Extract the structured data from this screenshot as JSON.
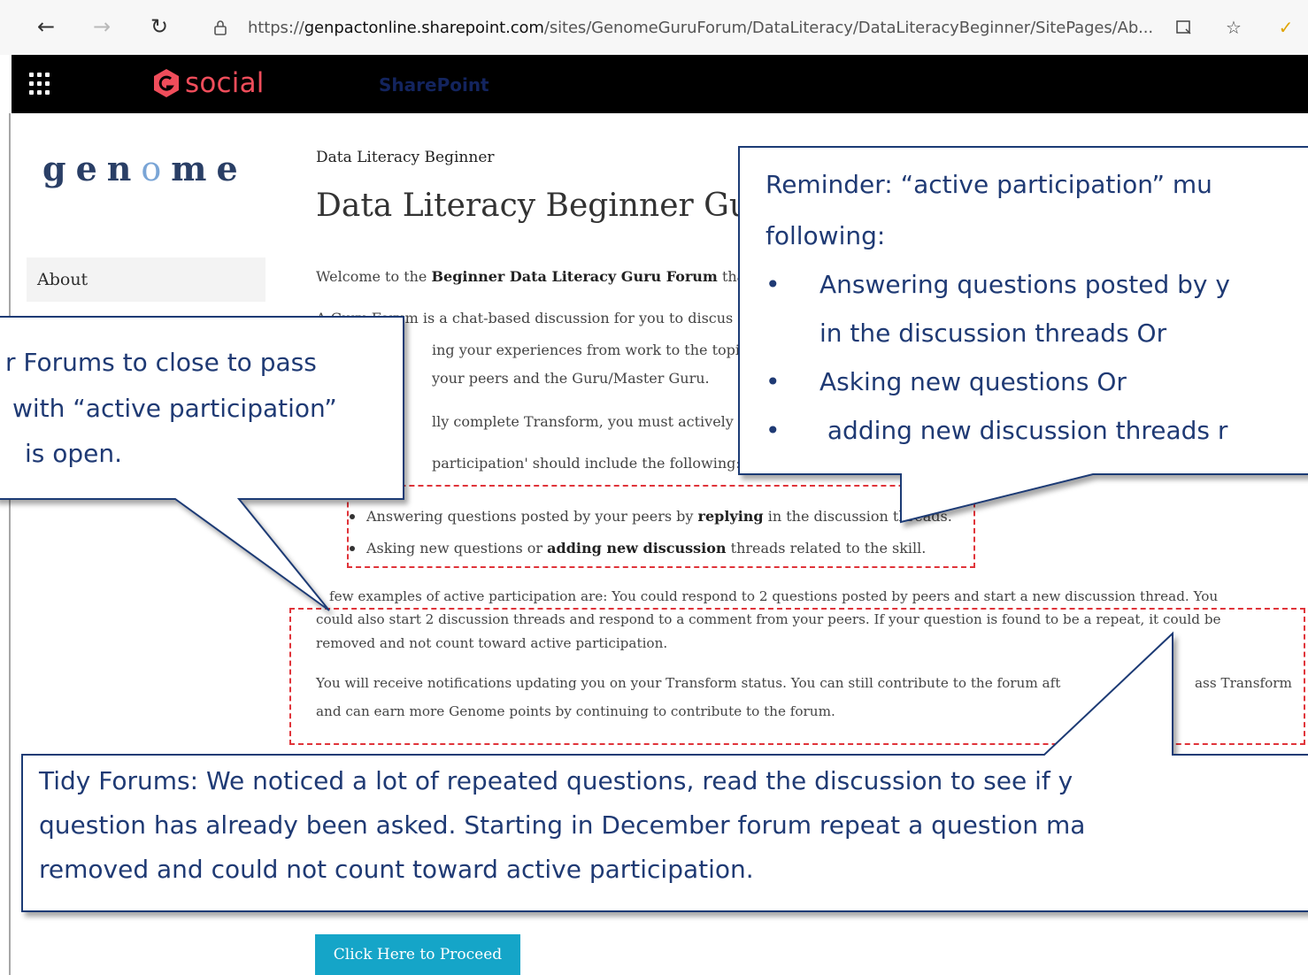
{
  "browser": {
    "url_prefix": "https://",
    "url_domain": "genpactonline.sharepoint.com",
    "url_path": "/sites/GenomeGuruForum/DataLiteracy/DataLiteracyBeginner/SitePages/Ab..."
  },
  "suite_bar": {
    "brand": "social",
    "app_link": "SharePoint"
  },
  "sidebar": {
    "logo": {
      "part1": "gen",
      "part2": "o",
      "part3": "me"
    },
    "items": [
      {
        "label": "About"
      }
    ]
  },
  "main": {
    "breadcrumb": "Data Literacy Beginner",
    "title": "Data Literacy Beginner Guru",
    "welcome_prefix": "Welcome to the ",
    "welcome_bold": "Beginner Data Literacy Guru Forum",
    "welcome_suffix": " that i",
    "forum_desc_1": "A Guru Forum is a chat-based discussion for you to discus",
    "forum_desc_2": "ing your experiences from work to the topic, s",
    "forum_desc_3": "your peers and the Guru/Master Guru.",
    "transform_line": "lly complete Transform, you must actively pa",
    "participation_line": "participation' should include the following:",
    "bullets": [
      {
        "pre": "Answering questions posted by your peers by ",
        "bold": "replying",
        "post": " in the discussion threads."
      },
      {
        "pre": "Asking new questions or ",
        "bold": "adding new discussion",
        "post": " threads related to the skill."
      }
    ],
    "examples_1": "few examples of active participation are: You could respond to 2 questions posted by peers and start a new discussion thread. You",
    "examples_2": "could also start 2 discussion threads and respond to a comment from your peers. If your question is found to be a repeat, it could be",
    "examples_3": "removed and not count toward active participation.",
    "notify_1a": "You will receive notifications updating you on your Transform status. You can still contribute to the forum aft",
    "notify_1b": "ass Transform",
    "notify_2": "and can earn more Genome points by continuing to contribute to the forum.",
    "proceed_label": "Click Here to Proceed"
  },
  "callouts": {
    "reminder": {
      "line1": "Reminder: “active participation” mu",
      "line2": "following:",
      "bullet1a": "Answering questions posted by y",
      "bullet1b": "in the discussion threads Or",
      "bullet2": "Asking new questions Or",
      "bullet3": " adding new discussion threads r"
    },
    "forums_close": {
      "line1": "r Forums to close to pass",
      "line2": "with “active participation”",
      "line3": "is open."
    },
    "tidy": {
      "line1": "Tidy Forums: We noticed a lot of repeated questions, read the discussion to see if y",
      "line2": "question has already been asked. Starting in December forum repeat a question ma",
      "line3": "removed and could not count toward active participation."
    }
  },
  "colors": {
    "brand": "#f04d5b",
    "callout_border": "#1f3a74",
    "highlight_dash": "#e0343a",
    "proceed_button": "#15a5c8"
  }
}
